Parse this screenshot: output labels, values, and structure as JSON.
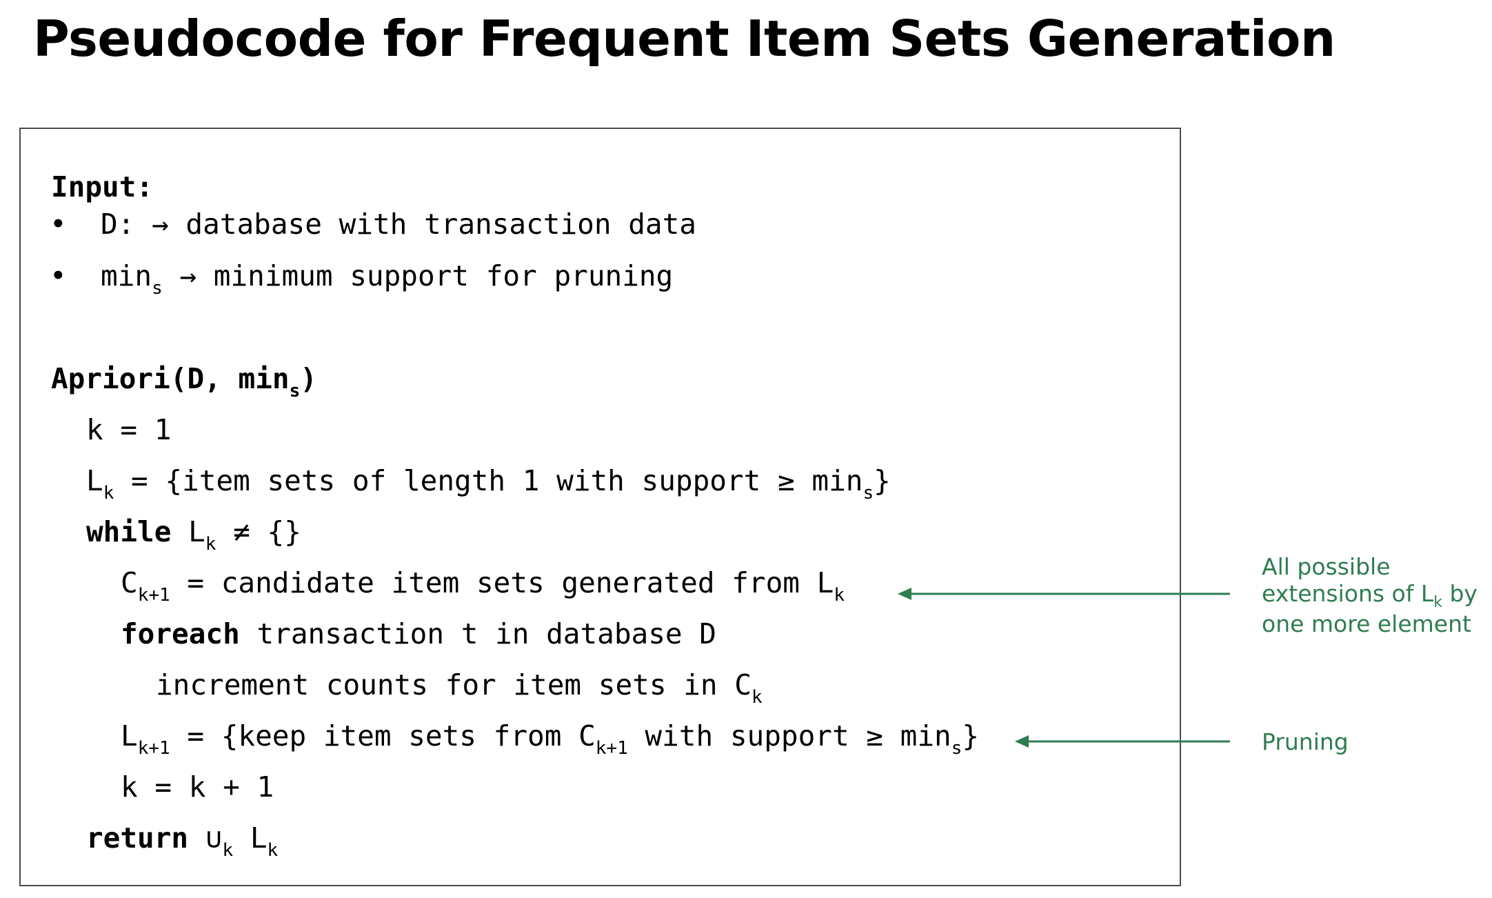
{
  "title": "Pseudocode for Frequent Item Sets Generation",
  "input": {
    "heading": "Input:",
    "bullet_symbol": "•",
    "items": [
      {
        "prefix": "D: → database with transaction data"
      },
      {
        "prefix": "min",
        "sub": "s",
        "suffix": " → minimum support for pruning"
      }
    ]
  },
  "code": {
    "func_name": "Apriori(D, min",
    "func_sub": "s",
    "func_close": ")",
    "line_k1": "k = 1",
    "lk_init": {
      "l": "L",
      "l_sub": "k",
      "rest": " = {item sets of length 1 with support ≥ min",
      "min_sub": "s",
      "close": "}"
    },
    "while_line": {
      "kw": "while",
      "l": " L",
      "l_sub": "k",
      "rest": " ≠ {}"
    },
    "ck_line": {
      "c": "C",
      "c_sub": "k+1",
      "rest": " = candidate item sets generated from L",
      "l_sub": "k"
    },
    "foreach_line": {
      "kw": "foreach",
      "rest": " transaction t in database D"
    },
    "increment_line": {
      "text": "increment counts for item sets in C",
      "c_sub": "k"
    },
    "lk1_line": {
      "l": "L",
      "l_sub": "k+1",
      "rest": " = {keep item sets from C",
      "c_sub": "k+1",
      "rest2": " with support ≥ min",
      "min_sub": "s",
      "close": "}"
    },
    "k_inc_line": "k = k + 1",
    "return_line": {
      "kw": "return",
      "union": " ∪",
      "u_sub": "k",
      "l": " L",
      "l_sub": "k"
    }
  },
  "annotations": {
    "extensions": {
      "line1": "All possible",
      "line2_pre": "extensions of L",
      "line2_sub": "k",
      "line2_post": " by",
      "line3": "one more element"
    },
    "pruning": "Pruning",
    "color": "#2e7d4f"
  }
}
